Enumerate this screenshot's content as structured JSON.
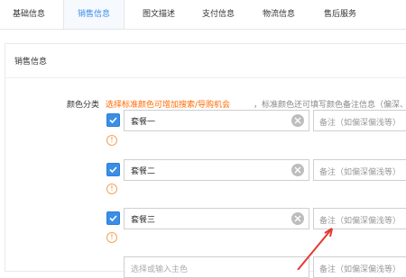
{
  "tabs": [
    {
      "label": "基础信息",
      "active": false
    },
    {
      "label": "销售信息",
      "active": true
    },
    {
      "label": "图文描述",
      "active": false
    },
    {
      "label": "支付信息",
      "active": false
    },
    {
      "label": "物流信息",
      "active": false
    },
    {
      "label": "售后服务",
      "active": false
    }
  ],
  "section": {
    "title": "销售信息"
  },
  "color_field": {
    "label": "颜色分类",
    "hint_highlight": "选择标准颜色可增加搜索/导购机会",
    "hint_rest": "，标准颜色还可填写颜色备注信息（偏深、偏亮"
  },
  "rows": [
    {
      "value": "套餐一",
      "note_placeholder": "备注（如偏深偏浅等）",
      "checked": true
    },
    {
      "value": "套餐二",
      "note_placeholder": "备注（如偏深偏浅等）",
      "checked": true
    },
    {
      "value": "套餐三",
      "note_placeholder": "备注（如偏深偏浅等）",
      "checked": true
    }
  ],
  "new_row": {
    "placeholder": "选择或输入主色",
    "note_placeholder": "备注（如偏深偏浅等）"
  },
  "colors": {
    "accent": "#3a8ee6",
    "warning": "#ff6a00",
    "arrow": "#e53935"
  }
}
